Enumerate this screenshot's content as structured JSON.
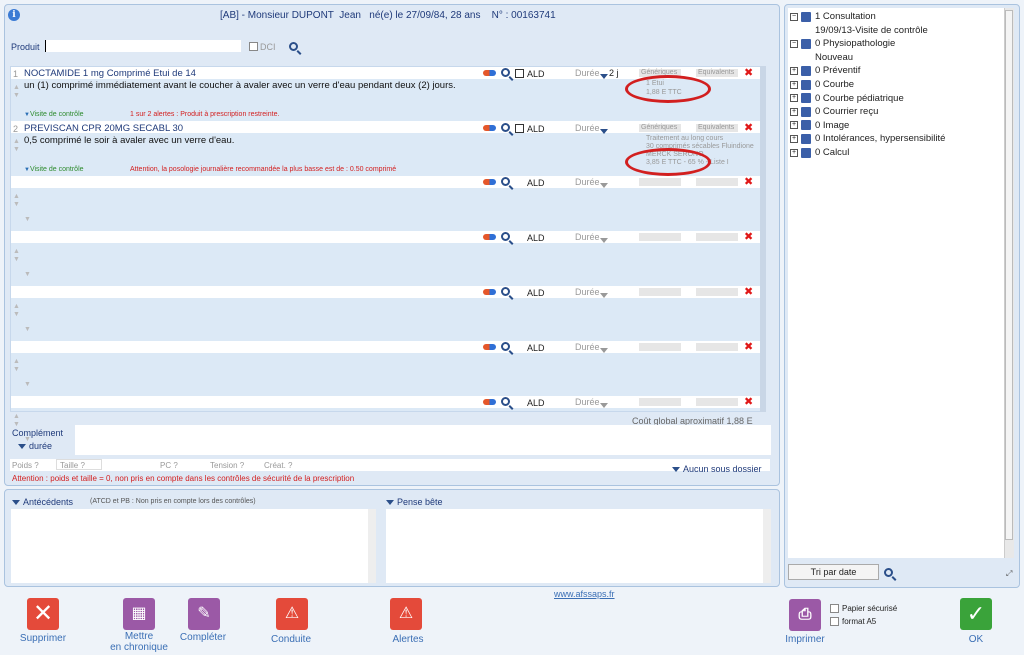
{
  "header": {
    "patient": "[AB] - Monsieur DUPONT  Jean   né(e) le 27/09/84, 28 ans    N° : 00163741"
  },
  "search": {
    "produit_label": "Produit",
    "dci_label": "DCI"
  },
  "lines": [
    {
      "num": "1",
      "name": "NOCTAMIDE 1 mg Comprimé Etui de 14",
      "posology": "un (1) comprimé immédiatement avant le coucher à avaler avec un verre d'eau pendant deux (2) jours.",
      "ald": "ALD",
      "duree": "Durée",
      "duree_value": "2 j",
      "generiques": "Génériques",
      "equivalents": "Equivalents",
      "info1": "1 Etui",
      "info2": "1,88 E TTC",
      "visite": "Visite de contrôle",
      "alert": "1 sur 2 alertes : Produit à prescription restreinte."
    },
    {
      "num": "2",
      "name": "PREVISCAN CPR 20MG SECABL 30",
      "posology": "0,5 comprimé le soir à avaler avec un verre d'eau.",
      "ald": "ALD",
      "duree": "Durée",
      "generiques": "Génériques",
      "equivalents": "Equivalents",
      "info1": "Traitement au long cours",
      "info2": "30 comprimés sécables   Fluindione",
      "info3": "MERCK SERONO",
      "info4": "3,85 E TTC - 65 % - Liste I",
      "visite": "Visite de contrôle",
      "alert": "Attention, la posologie journalière recommandée la plus basse est de : 0.50 comprimé"
    }
  ],
  "empty_rows": {
    "ald": "ALD",
    "duree": "Durée"
  },
  "cost": "Coût global aproximatif  1,88 E",
  "complement": {
    "label": "Complément",
    "duree": "durée"
  },
  "measures": {
    "poids": "Poids ?",
    "taille": "Taille ?",
    "pc": "PC ?",
    "tension": "Tension ?",
    "creat": "Créat. ?",
    "warning": "Attention : poids et taille = 0, non pris en compte dans les contrôles de sécurité de la prescription",
    "sous_dossier": "Aucun sous dossier"
  },
  "antecedents": {
    "title": "Antécédents",
    "note": "(ATCD et PB : Non pris en compte lors des contrôles)"
  },
  "pense_bete": {
    "title": "Pense bête"
  },
  "tree": [
    {
      "pm": "−",
      "label": "1 Consultation"
    },
    {
      "pm": "",
      "label": "19/09/13-Visite de contrôle"
    },
    {
      "pm": "−",
      "label": "0 Physiopathologie"
    },
    {
      "pm": "",
      "label": "Nouveau"
    },
    {
      "pm": "+",
      "label": "0 Préventif"
    },
    {
      "pm": "+",
      "label": "0 Courbe"
    },
    {
      "pm": "+",
      "label": "0 Courbe pédiatrique"
    },
    {
      "pm": "+",
      "label": "0 Courrier reçu"
    },
    {
      "pm": "+",
      "label": "0 Image"
    },
    {
      "pm": "+",
      "label": "0 Intolérances, hypersensibilité"
    },
    {
      "pm": "+",
      "label": "0 Calcul"
    }
  ],
  "tri": "Tri par date",
  "link": "www.afssaps.fr",
  "buttons": {
    "supprimer": "Supprimer",
    "chronique_1": "Mettre",
    "chronique_2": "en chronique",
    "completer": "Compléter",
    "conduite": "Conduite",
    "alertes": "Alertes",
    "imprimer": "Imprimer",
    "papier": "Papier sécurisé",
    "format": "format A5",
    "ok": "OK"
  },
  "colors": {
    "accent": "#3b6fb5",
    "alert_red": "#d32020",
    "ok_green": "#3aa33a",
    "purple": "#9b59a6"
  }
}
